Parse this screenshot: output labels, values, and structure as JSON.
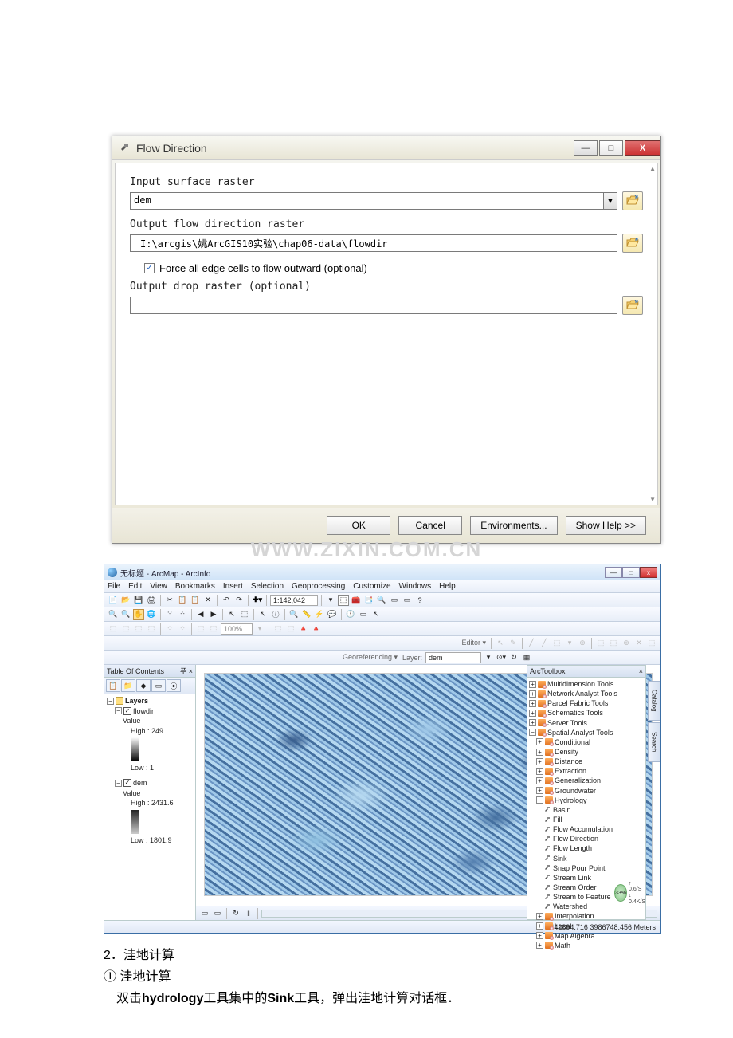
{
  "dialog": {
    "title": "Flow Direction",
    "input_label": "Input surface raster",
    "input_value": "dem",
    "output_label": "Output flow direction raster",
    "output_value": "I:\\arcgis\\姚ArcGIS10实验\\chap06-data\\flowdir",
    "force_label": "Force all edge cells to flow outward (optional)",
    "force_checked": "✓",
    "drop_label": "Output drop raster (optional)",
    "drop_value": "",
    "buttons": {
      "ok": "OK",
      "cancel": "Cancel",
      "env": "Environments...",
      "help": "Show Help >>"
    },
    "win": {
      "min": "—",
      "max": "□",
      "close": "X"
    }
  },
  "watermark": "WWW.ZIXIN.COM.CN",
  "arcmap": {
    "title": "无标题 - ArcMap - ArcInfo",
    "win": {
      "min": "—",
      "max": "□",
      "close": "x"
    },
    "menus": [
      "File",
      "Edit",
      "View",
      "Bookmarks",
      "Insert",
      "Selection",
      "Geoprocessing",
      "Customize",
      "Windows",
      "Help"
    ],
    "scale": "1:142,042",
    "georef": {
      "label": "Georeferencing ▾",
      "layer_lbl": "Layer:",
      "layer_val": "dem"
    },
    "editor": "Editor ▾",
    "toc": {
      "title": "Table Of Contents",
      "pin": "푸 ×",
      "layers": "Layers",
      "flowdir": "flowdir",
      "value": "Value",
      "flow_high": "High : 249",
      "flow_low": "Low : 1",
      "dem": "dem",
      "dem_high": "High : 2431.6",
      "dem_low": "Low : 1801.9"
    },
    "arctoolbox": {
      "title": "ArcToolbox",
      "close": "×",
      "items": [
        {
          "lv": 0,
          "ex": "+",
          "ty": "tb",
          "txt": "Multidimension Tools"
        },
        {
          "lv": 0,
          "ex": "+",
          "ty": "tb",
          "txt": "Network Analyst Tools"
        },
        {
          "lv": 0,
          "ex": "+",
          "ty": "tb",
          "txt": "Parcel Fabric Tools"
        },
        {
          "lv": 0,
          "ex": "+",
          "ty": "tb",
          "txt": "Schematics Tools"
        },
        {
          "lv": 0,
          "ex": "+",
          "ty": "tb",
          "txt": "Server Tools"
        },
        {
          "lv": 0,
          "ex": "−",
          "ty": "tb",
          "txt": "Spatial Analyst Tools"
        },
        {
          "lv": 1,
          "ex": "+",
          "ty": "tb",
          "txt": "Conditional"
        },
        {
          "lv": 1,
          "ex": "+",
          "ty": "tb",
          "txt": "Density"
        },
        {
          "lv": 1,
          "ex": "+",
          "ty": "tb",
          "txt": "Distance"
        },
        {
          "lv": 1,
          "ex": "+",
          "ty": "tb",
          "txt": "Extraction"
        },
        {
          "lv": 1,
          "ex": "+",
          "ty": "tb",
          "txt": "Generalization"
        },
        {
          "lv": 1,
          "ex": "+",
          "ty": "tb",
          "txt": "Groundwater"
        },
        {
          "lv": 1,
          "ex": "−",
          "ty": "tb",
          "txt": "Hydrology"
        },
        {
          "lv": 2,
          "ex": "",
          "ty": "tl",
          "txt": "Basin"
        },
        {
          "lv": 2,
          "ex": "",
          "ty": "tl",
          "txt": "Fill"
        },
        {
          "lv": 2,
          "ex": "",
          "ty": "tl",
          "txt": "Flow Accumulation"
        },
        {
          "lv": 2,
          "ex": "",
          "ty": "tl",
          "txt": "Flow Direction"
        },
        {
          "lv": 2,
          "ex": "",
          "ty": "tl",
          "txt": "Flow Length"
        },
        {
          "lv": 2,
          "ex": "",
          "ty": "tl",
          "txt": "Sink"
        },
        {
          "lv": 2,
          "ex": "",
          "ty": "tl",
          "txt": "Snap Pour Point"
        },
        {
          "lv": 2,
          "ex": "",
          "ty": "tl",
          "txt": "Stream Link"
        },
        {
          "lv": 2,
          "ex": "",
          "ty": "tl",
          "txt": "Stream Order"
        },
        {
          "lv": 2,
          "ex": "",
          "ty": "tl",
          "txt": "Stream to Feature"
        },
        {
          "lv": 2,
          "ex": "",
          "ty": "tl",
          "txt": "Watershed"
        },
        {
          "lv": 1,
          "ex": "+",
          "ty": "tb",
          "txt": "Interpolation"
        },
        {
          "lv": 1,
          "ex": "+",
          "ty": "tb",
          "txt": "Local"
        },
        {
          "lv": 1,
          "ex": "+",
          "ty": "tb",
          "txt": "Map Algebra"
        },
        {
          "lv": 1,
          "ex": "+",
          "ty": "tb",
          "txt": "Math"
        }
      ]
    },
    "status": "442894.716 3986748.456 Meters",
    "scale_badge": {
      "pct": "33%",
      "s1": "↑ 0.6/S",
      "s2": "↓ 0.4K/S"
    }
  },
  "doc": {
    "l1": "2．洼地计算",
    "l2": "① 洼地计算",
    "l3_a": " 双击",
    "l3_b": "hydrology",
    "l3_c": "工具集中的",
    "l3_d": "Sink",
    "l3_e": "工具，弹出洼地计算对话框．"
  }
}
